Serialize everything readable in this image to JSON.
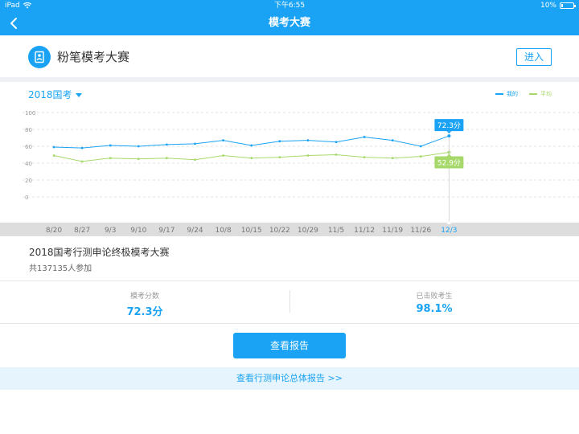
{
  "status_bar": {
    "device": "iPad",
    "time": "下午6:55",
    "battery": "10%"
  },
  "nav": {
    "title": "模考大赛"
  },
  "header": {
    "name": "粉笔模考大赛",
    "enter_label": "进入"
  },
  "chart_controls": {
    "year_label": "2018国考"
  },
  "legend": [
    {
      "name": "我的",
      "color": "#1aa3f4"
    },
    {
      "name": "平均",
      "color": "#a6d96a"
    }
  ],
  "chart_data": {
    "type": "line",
    "categories": [
      "8/20",
      "8/27",
      "9/3",
      "9/10",
      "9/17",
      "9/24",
      "10/8",
      "10/15",
      "10/22",
      "10/29",
      "11/5",
      "11/12",
      "11/19",
      "11/26",
      "12/3"
    ],
    "selected_category": "12/3",
    "yticks": [
      0,
      20,
      40,
      60,
      80,
      100
    ],
    "ylim": [
      0,
      100
    ],
    "grid": true,
    "series": [
      {
        "name": "我的",
        "color": "#1aa3f4",
        "values": [
          59,
          58,
          61,
          60,
          62,
          63,
          67,
          61,
          66,
          67,
          65,
          71,
          67,
          60,
          72.3
        ]
      },
      {
        "name": "平均",
        "color": "#a6d96a",
        "values": [
          49,
          42,
          46,
          45,
          46,
          44,
          49,
          46,
          47,
          49,
          50,
          47,
          46,
          48,
          52.9
        ]
      }
    ],
    "callouts": {
      "mine": "72.3分",
      "average": "52.9分"
    }
  },
  "exam": {
    "title": "2018国考行测申论终极模考大赛",
    "participants": "共137135人参加"
  },
  "stats": {
    "score_label": "模考分数",
    "score_value": "72.3分",
    "beat_label": "已击败考生",
    "beat_value": "98.1%"
  },
  "report_button": "查看报告",
  "overall_link": "查看行测申论总体报告 >>"
}
